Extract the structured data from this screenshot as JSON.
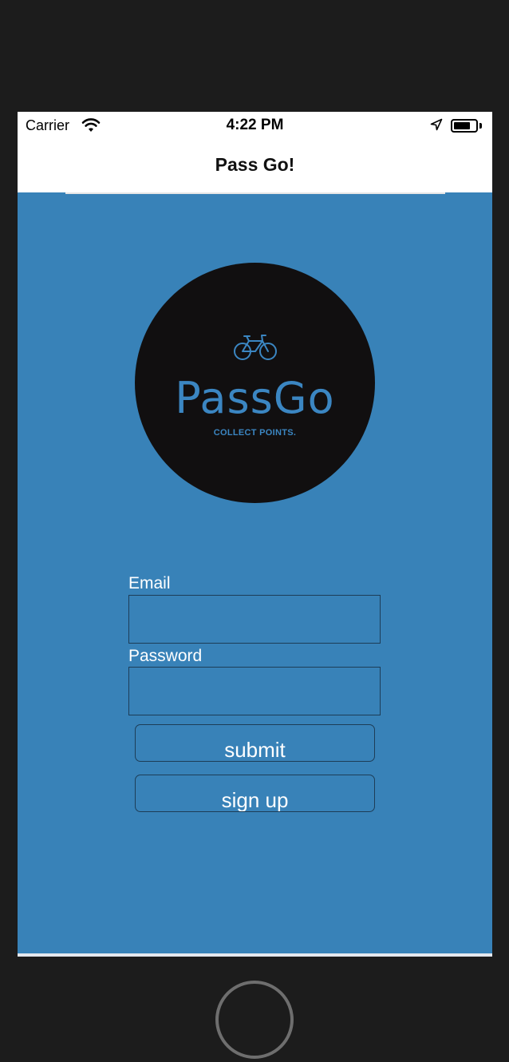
{
  "status_bar": {
    "carrier": "Carrier",
    "time": "4:22 PM",
    "wifi_icon": "wifi-icon",
    "location_icon": "location-arrow-icon",
    "battery_icon": "battery-icon"
  },
  "nav": {
    "title": "Pass Go!"
  },
  "logo": {
    "icon": "bicycle-icon",
    "name": "PassGo",
    "tagline": "COLLECT POINTS."
  },
  "form": {
    "email_label": "Email",
    "email_value": "",
    "password_label": "Password",
    "password_value": "",
    "submit_label": "submit",
    "signup_label": "sign up"
  },
  "colors": {
    "background": "#3882b8",
    "logo_circle": "#110f10",
    "logo_accent": "#3b86c2",
    "field_border": "#1d3d57",
    "device_frame": "#1c1c1c"
  }
}
